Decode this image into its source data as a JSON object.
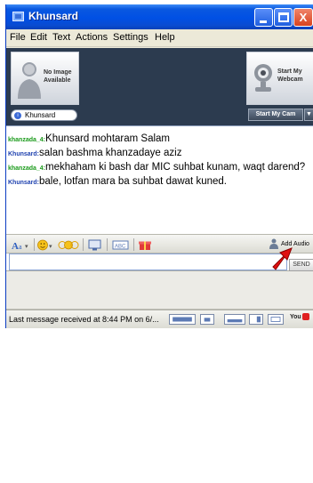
{
  "window": {
    "title": "Khunsard"
  },
  "title_buttons": {
    "minimize": "",
    "maximize": "",
    "close": "X"
  },
  "menu": {
    "items": [
      "File",
      "Edit",
      "Text",
      "Actions",
      "Settings",
      "Help"
    ]
  },
  "profile": {
    "no_image_line1": "No Image",
    "no_image_line2": "Available",
    "username": "Khunsard",
    "webcam_line1": "Start My",
    "webcam_line2": "Webcam",
    "start_cam_button": "Start My Cam",
    "start_cam_dropdown": "▼"
  },
  "chat": {
    "messages": [
      {
        "nick": "khanzada_4:",
        "text": "Khunsard mohtaram Salam"
      },
      {
        "nick": "Khunsard:",
        "text": "salan bashma khanzadaye aziz"
      },
      {
        "nick": "khanzada_4:",
        "text": "mekhaham ki bash dar MIC suhbat kunam, waqt darend?"
      },
      {
        "nick": "Khunsard:",
        "text": "bale, lotfan mara ba suhbat dawat kuned."
      }
    ]
  },
  "toolbar": {
    "add_audio": "Add Audio"
  },
  "input": {
    "value": "",
    "send_label": "SEND"
  },
  "status": {
    "text": "Last message received at 8:44 PM on 6/...",
    "youtube_label": "You"
  },
  "colors": {
    "titlebar": "#0a58e0",
    "header_panel": "#2c3b4f",
    "nick_green": "#1a9a1a",
    "nick_blue": "#1c3fae",
    "arrow": "#e01010"
  }
}
